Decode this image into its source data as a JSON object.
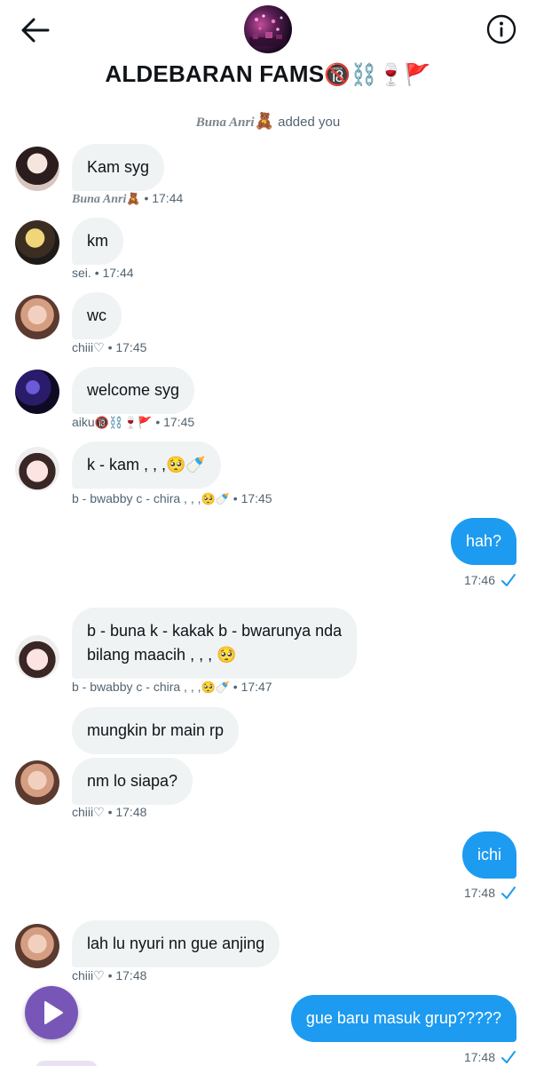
{
  "header": {
    "title": "ALDEBARAN FAMS",
    "title_emojis": "🔞⛓️🍷🚩",
    "back_icon": "arrow-left-icon",
    "info_icon": "info-circle-icon"
  },
  "system_note": {
    "who": "Buna Anri",
    "who_emoji": "🧸",
    "text": "added you"
  },
  "messages": [
    {
      "text": "Kam syg",
      "sender": "Buna Anri",
      "sender_emoji": "🧸",
      "time": "17:44"
    },
    {
      "text": "km",
      "sender": "sei.",
      "time": "17:44"
    },
    {
      "text": "wc",
      "sender": "chiii♡",
      "time": "17:45"
    },
    {
      "text": "welcome syg",
      "sender": "aiku",
      "sender_emoji": "🔞⛓️🍷🚩",
      "time": "17:45"
    },
    {
      "text": "k - kam , , ,",
      "text_emoji": "🥺🍼",
      "sender": "b - bwabby c - chira , , ,",
      "sender_emoji": "🥺🍼",
      "time": "17:45"
    },
    {
      "text": "hah?",
      "time": "17:46",
      "outgoing": true
    },
    {
      "text_line1": "b - buna k - kakak b - bwarunya nda",
      "text_line2": "bilang maacih , , ,",
      "text_emoji": "🥺",
      "sender": "b - bwabby c - chira , , ,",
      "sender_emoji": "🥺🍼",
      "time": "17:47"
    },
    {
      "text": "mungkin br main rp"
    },
    {
      "text": "nm lo siapa?",
      "sender": "chiii♡",
      "time": "17:48"
    },
    {
      "text": "ichi",
      "time": "17:48",
      "outgoing": true
    },
    {
      "text": "lah lu nyuri nn gue anjing",
      "sender": "chiii♡",
      "time": "17:48"
    },
    {
      "text": "gue baru masuk grup?????",
      "time": "17:48",
      "outgoing": true
    }
  ],
  "separator": "•",
  "icons": {
    "read_check": "check-icon",
    "play": "play-icon"
  },
  "colors": {
    "accent": "#1d9bf0",
    "bubble_in": "#eff3f4",
    "meta_text": "#536471",
    "fab": "#7856b8"
  }
}
